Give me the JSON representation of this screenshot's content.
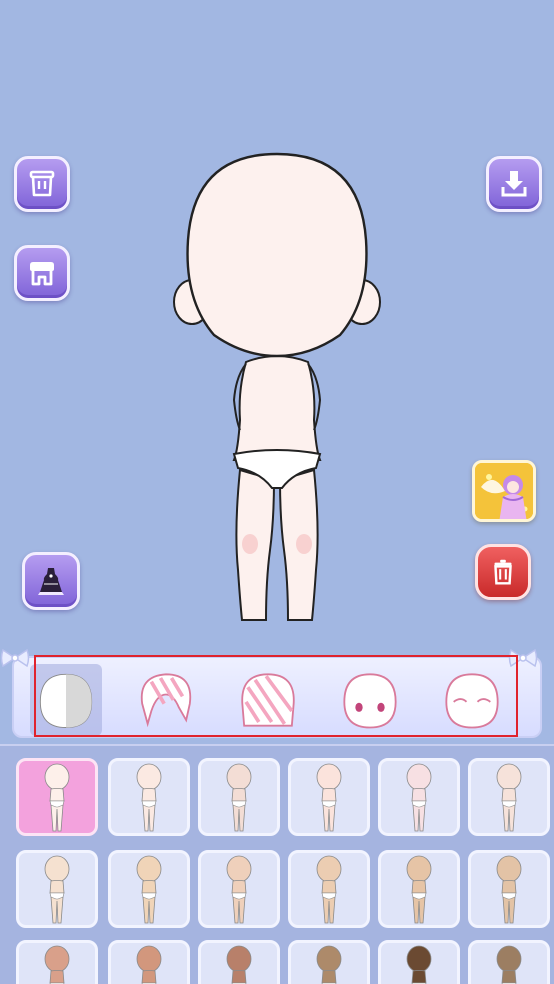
{
  "colors": {
    "background": "#a2b7e2",
    "accent_purple": "#8a6fe0",
    "delete_red": "#d93636",
    "selected_cell": "#f3a2dd",
    "highlight_border": "#e0232d"
  },
  "left_buttons": [
    {
      "name": "wardrobe-icon"
    },
    {
      "name": "shop-icon"
    },
    {
      "name": "dress-preset-icon"
    }
  ],
  "right_buttons": [
    {
      "name": "download-icon"
    },
    {
      "name": "fairy-character-thumbnail"
    },
    {
      "name": "trash-icon"
    }
  ],
  "category_tabs": [
    {
      "name": "tab-body",
      "icon": "body-icon",
      "active": true
    },
    {
      "name": "tab-front-hair",
      "icon": "front-hair-icon",
      "active": false
    },
    {
      "name": "tab-back-hair",
      "icon": "back-hair-icon",
      "active": false
    },
    {
      "name": "tab-eyes",
      "icon": "eyes-icon",
      "active": false
    },
    {
      "name": "tab-closed-eyes",
      "icon": "closed-eyes-icon",
      "active": false
    }
  ],
  "skin_tones": [
    [
      "#fdf0ea",
      "#fbe9e2",
      "#f3ddd5",
      "#fbe3dc",
      "#f7e0e3",
      "#f6e2da"
    ],
    [
      "#f5e1d0",
      "#f0d4b8",
      "#efd0bb",
      "#eccdb2",
      "#e6c4a6",
      "#e3c3a6"
    ],
    [
      "#d9a08a",
      "#d2977d",
      "#b8806a",
      "#ad8a6a",
      "#6b4a32",
      "#9c7e62"
    ]
  ],
  "selected_skin_index": 0
}
